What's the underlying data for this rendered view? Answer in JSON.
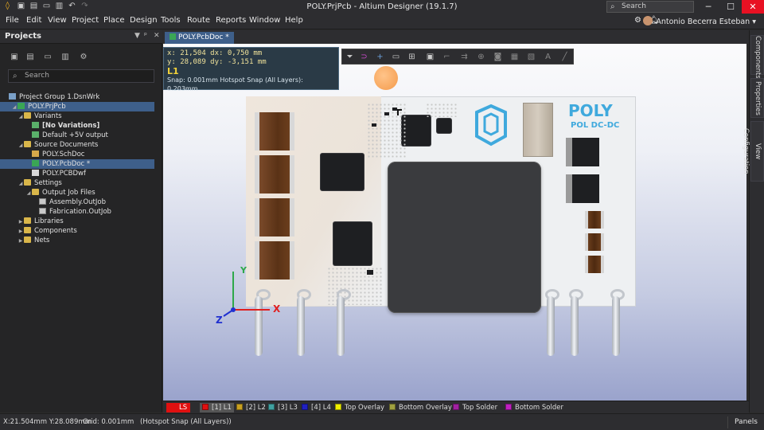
{
  "window": {
    "title": "POLY.PrjPcb - Altium Designer (19.1.7)",
    "search_placeholder": "Search",
    "minimize": "─",
    "maximize": "☐",
    "close": "✕"
  },
  "menu": [
    "File",
    "Edit",
    "View",
    "Project",
    "Place",
    "Design",
    "Tools",
    "Route",
    "Reports",
    "Window",
    "Help"
  ],
  "user": {
    "name": "Antonio Becerra Esteban"
  },
  "projects_panel": {
    "title": "Projects",
    "search_placeholder": "Search",
    "tree": [
      {
        "label": "Project Group 1.DsnWrk"
      },
      {
        "label": "POLY.PrjPcb"
      },
      {
        "label": "Variants"
      },
      {
        "label": "[No Variations]"
      },
      {
        "label": "Default +5V output"
      },
      {
        "label": "Source Documents"
      },
      {
        "label": "POLY.SchDoc"
      },
      {
        "label": "POLY.PcbDoc *"
      },
      {
        "label": "POLY.PCBDwf"
      },
      {
        "label": "Settings"
      },
      {
        "label": "Output Job Files"
      },
      {
        "label": "Assembly.OutJob"
      },
      {
        "label": "Fabrication.OutJob"
      },
      {
        "label": "Libraries"
      },
      {
        "label": "Components"
      },
      {
        "label": "Nets"
      }
    ]
  },
  "document_tab": {
    "label": "POLY.PcbDoc *"
  },
  "readout": {
    "line1": "x: 21,504   dx:  0,750 mm",
    "line2": "y: 28,089   dy: -3,151 mm",
    "layer": "L1",
    "snap": "Snap: 0.001mm Hotspot Snap (All Layers): 0.203mm"
  },
  "board": {
    "logo_title": "POLY",
    "logo_subtitle": "POL DC-DC",
    "logo_color": "#3fa9dd"
  },
  "axes": {
    "x": "X",
    "y": "Y",
    "z": "Z"
  },
  "layers": [
    {
      "label": "LS",
      "color": "#e01010"
    },
    {
      "label": "[1] L1",
      "color": "#e01010"
    },
    {
      "label": "[2] L2",
      "color": "#c8a020"
    },
    {
      "label": "[3] L3",
      "color": "#40a0a0"
    },
    {
      "label": "[4] L4",
      "color": "#2020c0"
    },
    {
      "label": "Top Overlay",
      "color": "#f0f000"
    },
    {
      "label": "Bottom Overlay",
      "color": "#a0a040"
    },
    {
      "label": "Top Solder",
      "color": "#a020a0"
    },
    {
      "label": "Bottom Solder",
      "color": "#c020c0"
    }
  ],
  "right_tabs": [
    "Components",
    "Properties",
    "View Configuration"
  ],
  "status": {
    "coords": "X:21.504mm Y:28.089mm",
    "grid": "Grid: 0.001mm",
    "snap": "(Hotspot Snap (All Layers))",
    "panels": "Panels"
  }
}
